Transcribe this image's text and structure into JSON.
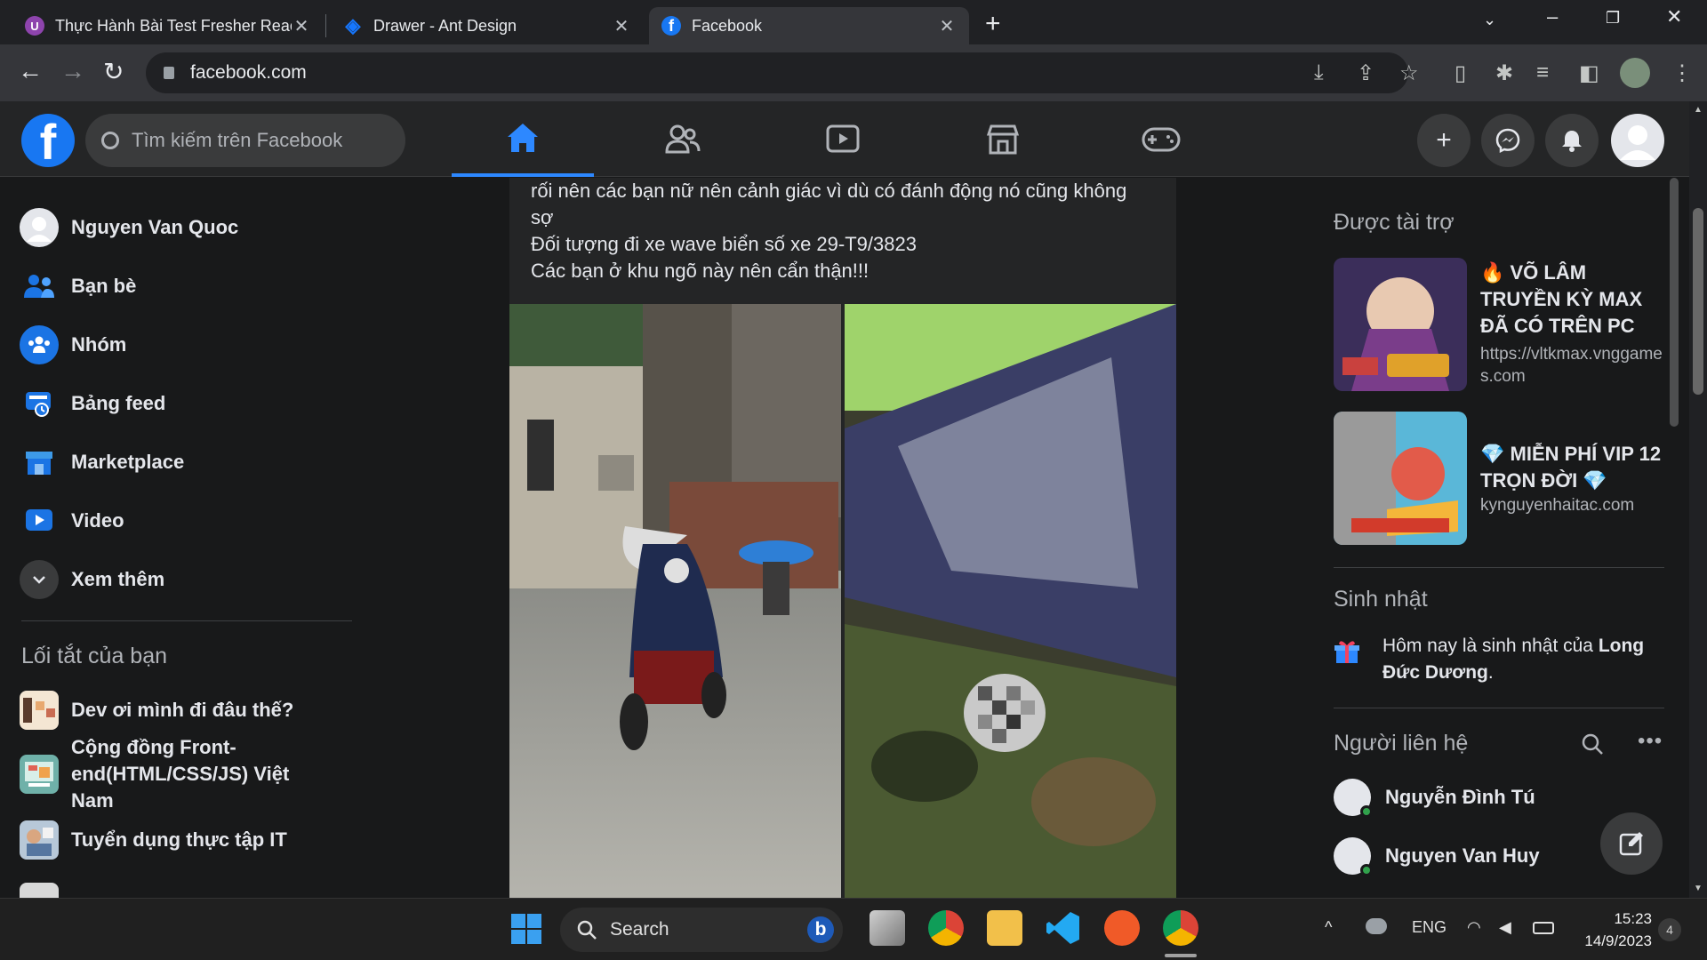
{
  "browser": {
    "tabs": [
      {
        "title": "Thực Hành Bài Test Fresher React",
        "icon": "u-logo-icon",
        "color": "#8e44ad"
      },
      {
        "title": "Drawer - Ant Design",
        "icon": "ant-design-icon",
        "color": "#1677ff"
      },
      {
        "title": "Facebook",
        "icon": "facebook-icon",
        "color": "#1877f2"
      }
    ],
    "url": "facebook.com"
  },
  "header": {
    "search_placeholder": "Tìm kiếm trên Facebook",
    "accent": "#2d88ff"
  },
  "left_sidebar": {
    "items": [
      {
        "label": "Nguyen Van Quoc",
        "icon": "avatar-icon"
      },
      {
        "label": "Bạn bè",
        "icon": "friends-icon"
      },
      {
        "label": "Nhóm",
        "icon": "groups-icon"
      },
      {
        "label": "Bảng feed",
        "icon": "feeds-icon"
      },
      {
        "label": "Marketplace",
        "icon": "marketplace-icon"
      },
      {
        "label": "Video",
        "icon": "video-icon"
      },
      {
        "label": "Xem thêm",
        "icon": "chevron-down-icon"
      }
    ],
    "shortcuts_heading": "Lối tắt của bạn",
    "shortcuts": [
      {
        "label": "Dev ơi mình đi đâu thế?"
      },
      {
        "label": "Cộng đồng Front-end(HTML/CSS/JS) Việt Nam"
      },
      {
        "label": "Tuyển dụng thực tập IT"
      }
    ]
  },
  "post": {
    "lines": [
      "rối nên các bạn nữ nên cảnh giác vì dù có đánh động nó cũng không sợ",
      "Đối tượng đi xe wave biển số xe 29-T9/3823",
      "Các bạn ở khu ngõ này nên cẩn thận!!!"
    ]
  },
  "right_sidebar": {
    "sponsored_heading": "Được tài trợ",
    "ads": [
      {
        "title": "🔥 VÕ LÂM TRUYỀN KỲ MAX ĐÃ CÓ TRÊN PC",
        "url": "https://vltkmax.vnggames.com"
      },
      {
        "title": "💎 MIỄN PHÍ VIP 12 TRỌN ĐỜI 💎",
        "url": "kynguyenhaitac.com"
      }
    ],
    "birthday_heading": "Sinh nhật",
    "birthday_prefix": "Hôm nay là sinh nhật của ",
    "birthday_name": "Long Đức Dương",
    "birthday_suffix": ".",
    "contacts_heading": "Người liên hệ",
    "contacts": [
      {
        "name": "Nguyễn Đình Tú"
      },
      {
        "name": "Nguyen Van Huy"
      }
    ]
  },
  "taskbar": {
    "search_label": "Search",
    "language": "ENG",
    "time": "15:23",
    "date": "14/9/2023",
    "notifications": "4"
  }
}
